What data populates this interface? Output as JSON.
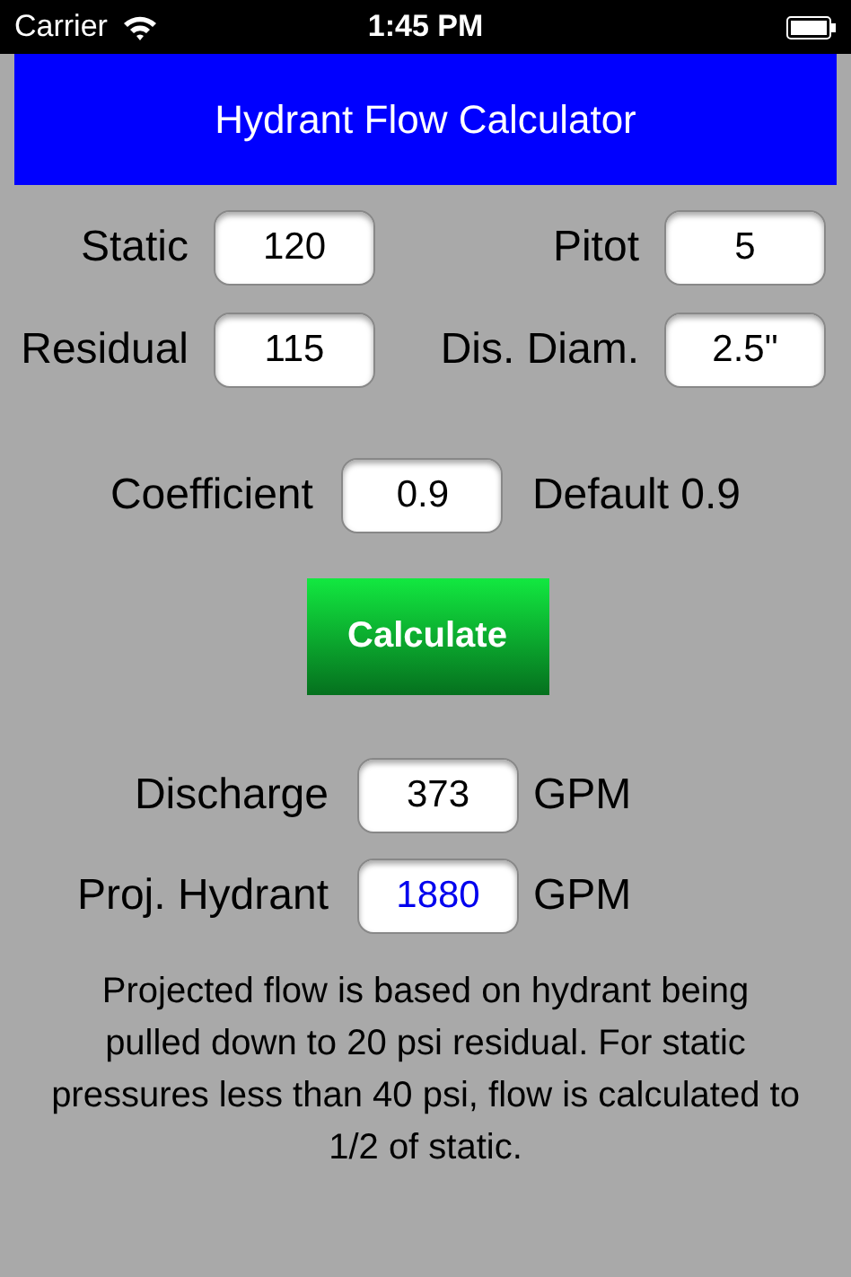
{
  "status_bar": {
    "carrier": "Carrier",
    "time": "1:45 PM"
  },
  "header": {
    "title": "Hydrant Flow Calculator"
  },
  "inputs": [
    {
      "label": "Static",
      "value": "120"
    },
    {
      "label": "Pitot",
      "value": "5"
    },
    {
      "label": "Residual",
      "value": "115"
    },
    {
      "label": "Dis. Diam.",
      "value": "2.5\""
    }
  ],
  "coefficient": {
    "label": "Coefficient",
    "value": "0.9",
    "hint": "Default 0.9"
  },
  "calculate_button": "Calculate",
  "results": [
    {
      "label": "Discharge",
      "value": "373",
      "unit": "GPM",
      "color": "#000000"
    },
    {
      "label": "Proj. Hydrant",
      "value": "1880",
      "unit": "GPM",
      "color": "#0000ee"
    }
  ],
  "note": "Projected flow is based on hydrant being pulled down to 20 psi residual. For static pressures less than 40 psi, flow is calculated to 1/2 of static."
}
